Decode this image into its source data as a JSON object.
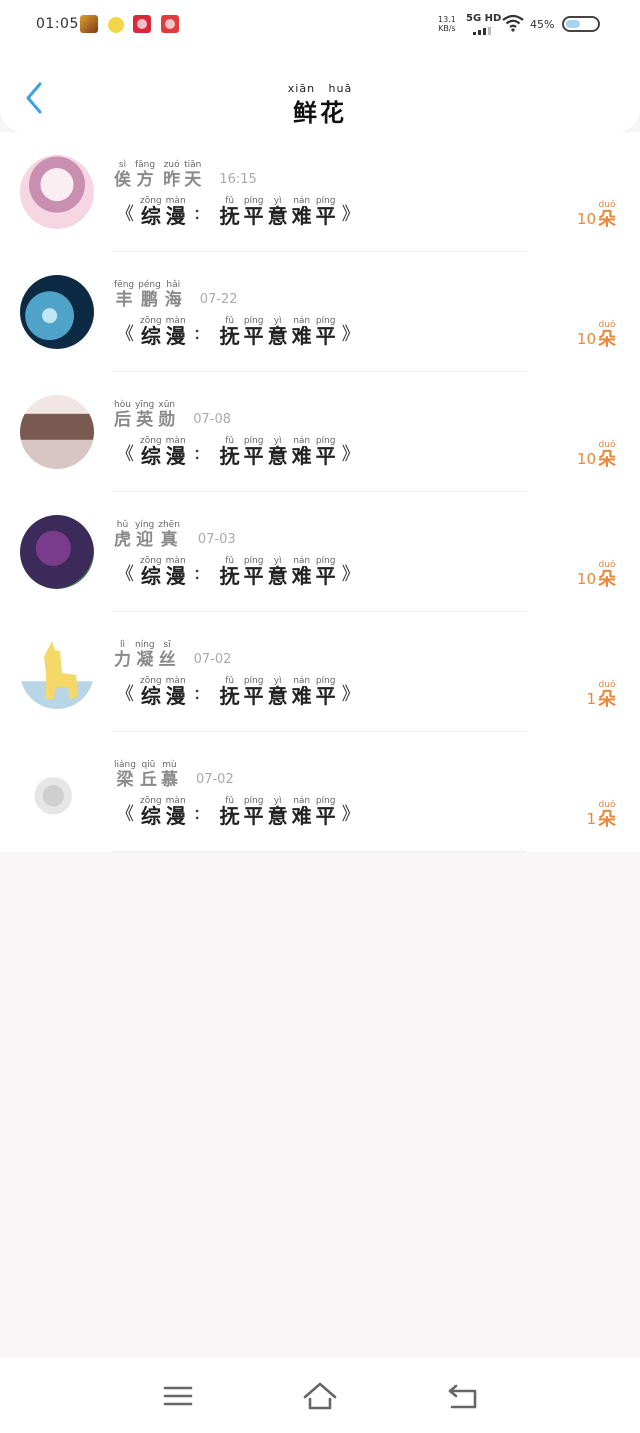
{
  "status_bar": {
    "time": "01:05",
    "net_speed_value": "13.1",
    "net_speed_unit": "KB/s",
    "network_type": "5G HD",
    "battery_percent": "45%",
    "battery_level": 0.45
  },
  "header": {
    "title_pinyin": [
      "xiān",
      "huā"
    ],
    "title_chars": [
      "鲜",
      "花"
    ]
  },
  "book_title": {
    "open_quote": "《",
    "close_quote": "》",
    "colon": "：",
    "part1": [
      {
        "py": "zōng",
        "hz": "综"
      },
      {
        "py": "màn",
        "hz": "漫"
      }
    ],
    "part2": [
      {
        "py": "fǔ",
        "hz": "抚"
      },
      {
        "py": "píng",
        "hz": "平"
      },
      {
        "py": "yì",
        "hz": "意"
      },
      {
        "py": "nán",
        "hz": "难"
      },
      {
        "py": "píng",
        "hz": "平"
      }
    ]
  },
  "unit": {
    "py": "duǒ",
    "hz": "朵"
  },
  "gifts": [
    {
      "name": [
        {
          "py": "sì",
          "hz": "俟"
        },
        {
          "py": "fāng",
          "hz": "方"
        },
        {
          "py": "",
          "hz": " "
        },
        {
          "py": "zuó",
          "hz": "昨"
        },
        {
          "py": "tiān",
          "hz": "天"
        }
      ],
      "time": "16:15",
      "count": "10"
    },
    {
      "name": [
        {
          "py": "fēng",
          "hz": "丰"
        },
        {
          "py": "péng",
          "hz": "鹏"
        },
        {
          "py": "hǎi",
          "hz": "海"
        }
      ],
      "time": "07-22",
      "count": "10"
    },
    {
      "name": [
        {
          "py": "hòu",
          "hz": "后"
        },
        {
          "py": "yīng",
          "hz": "英"
        },
        {
          "py": "xūn",
          "hz": "勋"
        }
      ],
      "time": "07-08",
      "count": "10"
    },
    {
      "name": [
        {
          "py": "hǔ",
          "hz": "虎"
        },
        {
          "py": "yíng",
          "hz": "迎"
        },
        {
          "py": "zhēn",
          "hz": "真"
        }
      ],
      "time": "07-03",
      "count": "10"
    },
    {
      "name": [
        {
          "py": "lì",
          "hz": "力"
        },
        {
          "py": "níng",
          "hz": "凝"
        },
        {
          "py": "sī",
          "hz": "丝"
        }
      ],
      "time": "07-02",
      "count": "1"
    },
    {
      "name": [
        {
          "py": "liáng",
          "hz": "梁"
        },
        {
          "py": "qiū",
          "hz": "丘"
        },
        {
          "py": "mù",
          "hz": "慕"
        }
      ],
      "time": "07-02",
      "count": "1"
    }
  ],
  "avatars": [
    {
      "icon": "anime-girl-avatar",
      "colors": [
        "#f6d6e2",
        "#c98fb0",
        "#fbeef3"
      ]
    },
    {
      "icon": "ocean-planet-avatar",
      "colors": [
        "#0d2a44",
        "#4fa3c9",
        "#bfe6f4"
      ]
    },
    {
      "icon": "portrait-photo-avatar",
      "colors": [
        "#d8c6c4",
        "#7a5a50",
        "#f1e6e4"
      ]
    },
    {
      "icon": "balloons-avatar",
      "colors": [
        "#3b2a5a",
        "#7a3c8a",
        "#3f7a4a"
      ]
    },
    {
      "icon": "alpaca-cartoon-avatar",
      "colors": [
        "#ffffff",
        "#f4d868",
        "#b9d6e6"
      ]
    },
    {
      "icon": "faded-sketch-avatar",
      "colors": [
        "#ffffff",
        "#e6e6e6",
        "#cfcfcf"
      ]
    }
  ],
  "colors": {
    "accent_blue": "#3aa0e8",
    "count_orange": "#e8893c"
  },
  "nav_icons": [
    "menu-icon",
    "home-icon",
    "back-icon"
  ]
}
